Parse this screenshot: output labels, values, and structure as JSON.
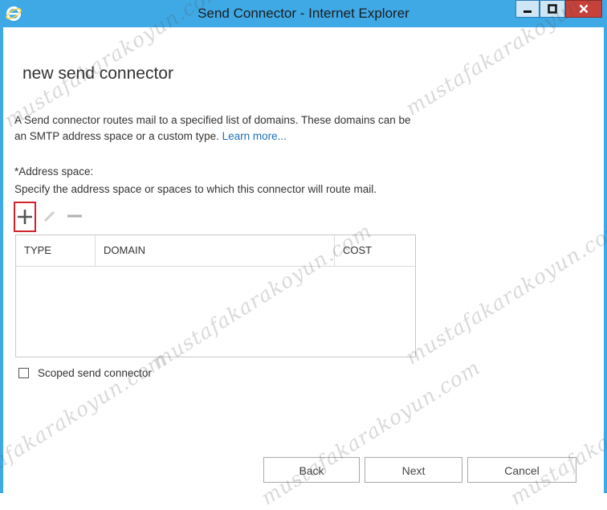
{
  "window": {
    "title": "Send Connector - Internet Explorer",
    "colors": {
      "frame": "#3fa9e6",
      "close": "#c7413a",
      "accent": "#d3232a",
      "link": "#1e70b8"
    }
  },
  "page": {
    "title": "new send connector",
    "description": "A Send connector routes mail to a specified list of domains. These domains can be an SMTP address space or a custom type.",
    "learn_more": "Learn more..."
  },
  "address_space": {
    "label": "*Address space:",
    "hint": "Specify the address space or spaces to which this connector will route mail.",
    "toolbar_icons": [
      "add-icon",
      "edit-icon",
      "remove-icon"
    ],
    "columns": [
      "TYPE",
      "DOMAIN",
      "COST"
    ],
    "rows": []
  },
  "scoped": {
    "label": "Scoped send connector",
    "checked": false
  },
  "buttons": {
    "back": "Back",
    "next": "Next",
    "cancel": "Cancel"
  },
  "watermark": "mustafakarakoyun.com"
}
